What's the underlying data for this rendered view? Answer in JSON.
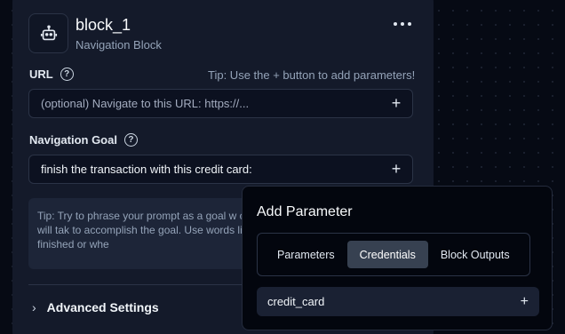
{
  "node": {
    "title": "block_1",
    "subtitle": "Navigation Block",
    "icon": "robot-icon",
    "url_label": "URL",
    "url_tip": "Tip: Use the + button to add parameters!",
    "url_placeholder": "(optional) Navigate to this URL: https://...",
    "goal_label": "Navigation Goal",
    "goal_value": "finish the transaction with this credit card:",
    "tip_text": "Tip: Try to phrase your prompt as a goal w criteria. While executing, Skyvern will tak to accomplish the goal. Use words like \"C Skyvern identify when it's finished or whe",
    "advanced_label": "Advanced Settings"
  },
  "popover": {
    "title": "Add Parameter",
    "tabs": [
      {
        "label": "Parameters",
        "active": false
      },
      {
        "label": "Credentials",
        "active": true
      },
      {
        "label": "Block Outputs",
        "active": false
      }
    ],
    "items": [
      {
        "label": "credit_card"
      }
    ]
  },
  "colors": {
    "canvas": "#060a14",
    "node": "#141a2a",
    "popover": "#03060e",
    "active_tab": "#374151"
  }
}
